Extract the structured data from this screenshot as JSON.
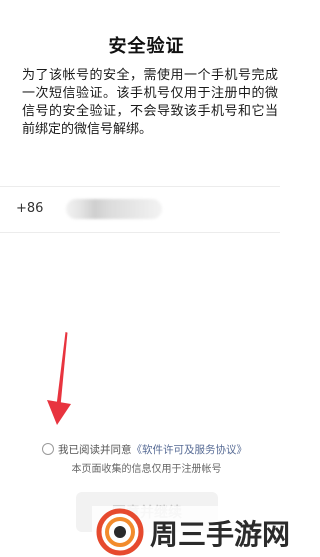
{
  "page": {
    "title": "安全验证",
    "description": "为了该帐号的安全，需使用一个手机号完成一次短信验证。该手机号仅用于注册中的微信号的安全验证，不会导致该手机号和它当前绑定的微信号解绑。"
  },
  "phone": {
    "country_code": "+86",
    "value": ""
  },
  "agreement": {
    "prefix": "我已阅读并同意",
    "link": "《软件许可及服务协议》",
    "checked": false
  },
  "notice": "本页面收集的信息仅用于注册帐号",
  "next_button": {
    "label": "同意并继续"
  },
  "watermark": {
    "text": "周三手游网"
  },
  "colors": {
    "link": "#576b95",
    "arrow": "#e8343f",
    "button_bg": "#f2f2f2",
    "button_text": "#c8c8c8"
  }
}
